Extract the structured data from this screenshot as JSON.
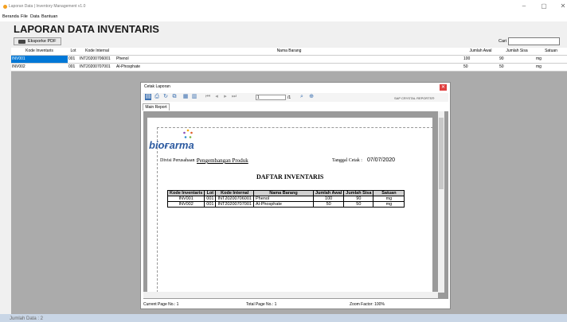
{
  "window": {
    "title": "Laporan Data | Inventory Management v1.0",
    "minimize": "–",
    "restore": "▢",
    "close": "✕"
  },
  "menu": {
    "items": [
      "Beranda",
      "File",
      "Data",
      "Bantuan"
    ]
  },
  "page": {
    "heading": "LAPORAN DATA INVENTARIS",
    "export_label": "Eksporke PDF",
    "search_label": "Cari",
    "search_value": ""
  },
  "grid": {
    "columns": [
      "Kode Inventaris",
      "Lot",
      "Kode Internal",
      "Nama Barang",
      "Jumlah Awal",
      "Jumlah Sisa",
      "Satuan"
    ],
    "rows": [
      {
        "kode": "INV001",
        "lot": "001",
        "internal": "INT20200706001",
        "nama": "Phenol",
        "awal": "100",
        "sisa": "90",
        "satuan": "mg"
      },
      {
        "kode": "INV002",
        "lot": "001",
        "internal": "INT20200707001",
        "nama": "Al-Phosphate",
        "awal": "50",
        "sisa": "50",
        "satuan": "mg"
      }
    ]
  },
  "status": {
    "text": "Jumlah Data : 2"
  },
  "dialog": {
    "title": "Cetak Laporan",
    "close": "✕",
    "page_input": "1",
    "page_total": "/1",
    "brand": "SAP CRYSTAL REPORTS®",
    "tab": "Main Report",
    "footer": {
      "current": "Current Page No.: 1",
      "total": "Total Page No.: 1",
      "zoom": "Zoom Factor: 100%"
    }
  },
  "report": {
    "logo": "bioғarma",
    "divisi_label": "Divisi Perusahaan :",
    "divisi_value": "Pengembangan Produk",
    "tanggal_label": "Tanggal Cetak :",
    "tanggal_value": "07/07/2020",
    "title": "DAFTAR INVENTARIS",
    "columns": [
      "Kode Inventaris",
      "Lot",
      "Kode Internal",
      "Nama Barang",
      "Jumlah Awal",
      "Jumlah Sisa",
      "Satuan"
    ],
    "rows": [
      [
        "INV001",
        "001",
        "INT20200706001",
        "Phenol",
        "100",
        "90",
        "mg"
      ],
      [
        "INV002",
        "001",
        "INT20200707001",
        "Al-Phosphate",
        "50",
        "50",
        "mg"
      ]
    ]
  }
}
